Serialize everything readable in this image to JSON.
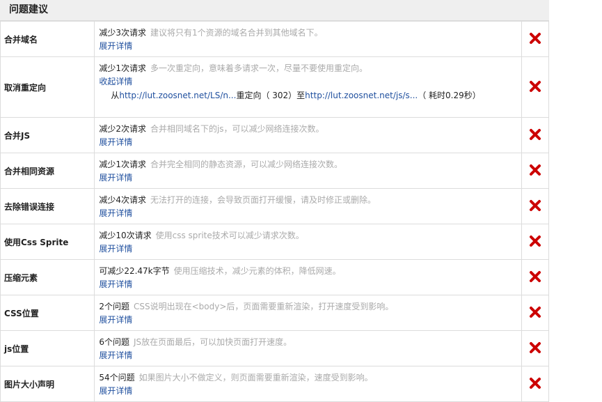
{
  "section_title": "问题建议",
  "expand_label": "展开详情",
  "collapse_label": "收起详情",
  "close_icon": "close-icon",
  "close_color": "#cc0000",
  "rows": [
    {
      "name": "合并域名",
      "count": "减少3次请求",
      "desc": "建议将只有1个资源的域名合并到其他域名下。",
      "expanded": false
    },
    {
      "name": "取消重定向",
      "count": "减少1次请求",
      "desc": "多一次重定向，意味着多请求一次，尽量不要使用重定向。",
      "expanded": true,
      "redirect": {
        "from_prefix": "从",
        "from_url": "http://lut.zoosnet.net/LS/n...",
        "mid_text": "重定向（ 302）至",
        "to_url": "http://lut.zoosnet.net/js/s...",
        "time_text": "（ 耗时0.29秒）"
      }
    },
    {
      "name": "合并JS",
      "count": "减少2次请求",
      "desc": "合并相同域名下的js，可以减少网络连接次数。",
      "expanded": false
    },
    {
      "name": "合并相同资源",
      "count": "减少1次请求",
      "desc": "合并完全相同的静态资源，可以减少网络连接次数。",
      "expanded": false
    },
    {
      "name": "去除错误连接",
      "count": "减少4次请求",
      "desc": "无法打开的连接，会导致页面打开缓慢，请及时修正或删除。",
      "expanded": false
    },
    {
      "name": "使用Css Sprite",
      "count": "减少10次请求",
      "desc": "使用css sprite技术可以减少请求次数。",
      "expanded": false
    },
    {
      "name": "压缩元素",
      "count": "可减少22.47k字节",
      "desc": "使用压缩技术，减少元素的体积，降低网速。",
      "expanded": false
    },
    {
      "name": "CSS位置",
      "count": "2个问题",
      "desc": "CSS说明出现在<body>后，页面需要重新渲染，打开速度受到影响。",
      "expanded": false
    },
    {
      "name": "js位置",
      "count": "6个问题",
      "desc": "JS放在页面最后，可以加快页面打开速度。",
      "expanded": false
    },
    {
      "name": "图片大小声明",
      "count": "54个问题",
      "desc": "如果图片大小不做定义，则页面需要重新渲染，速度受到影响。",
      "expanded": false
    }
  ]
}
